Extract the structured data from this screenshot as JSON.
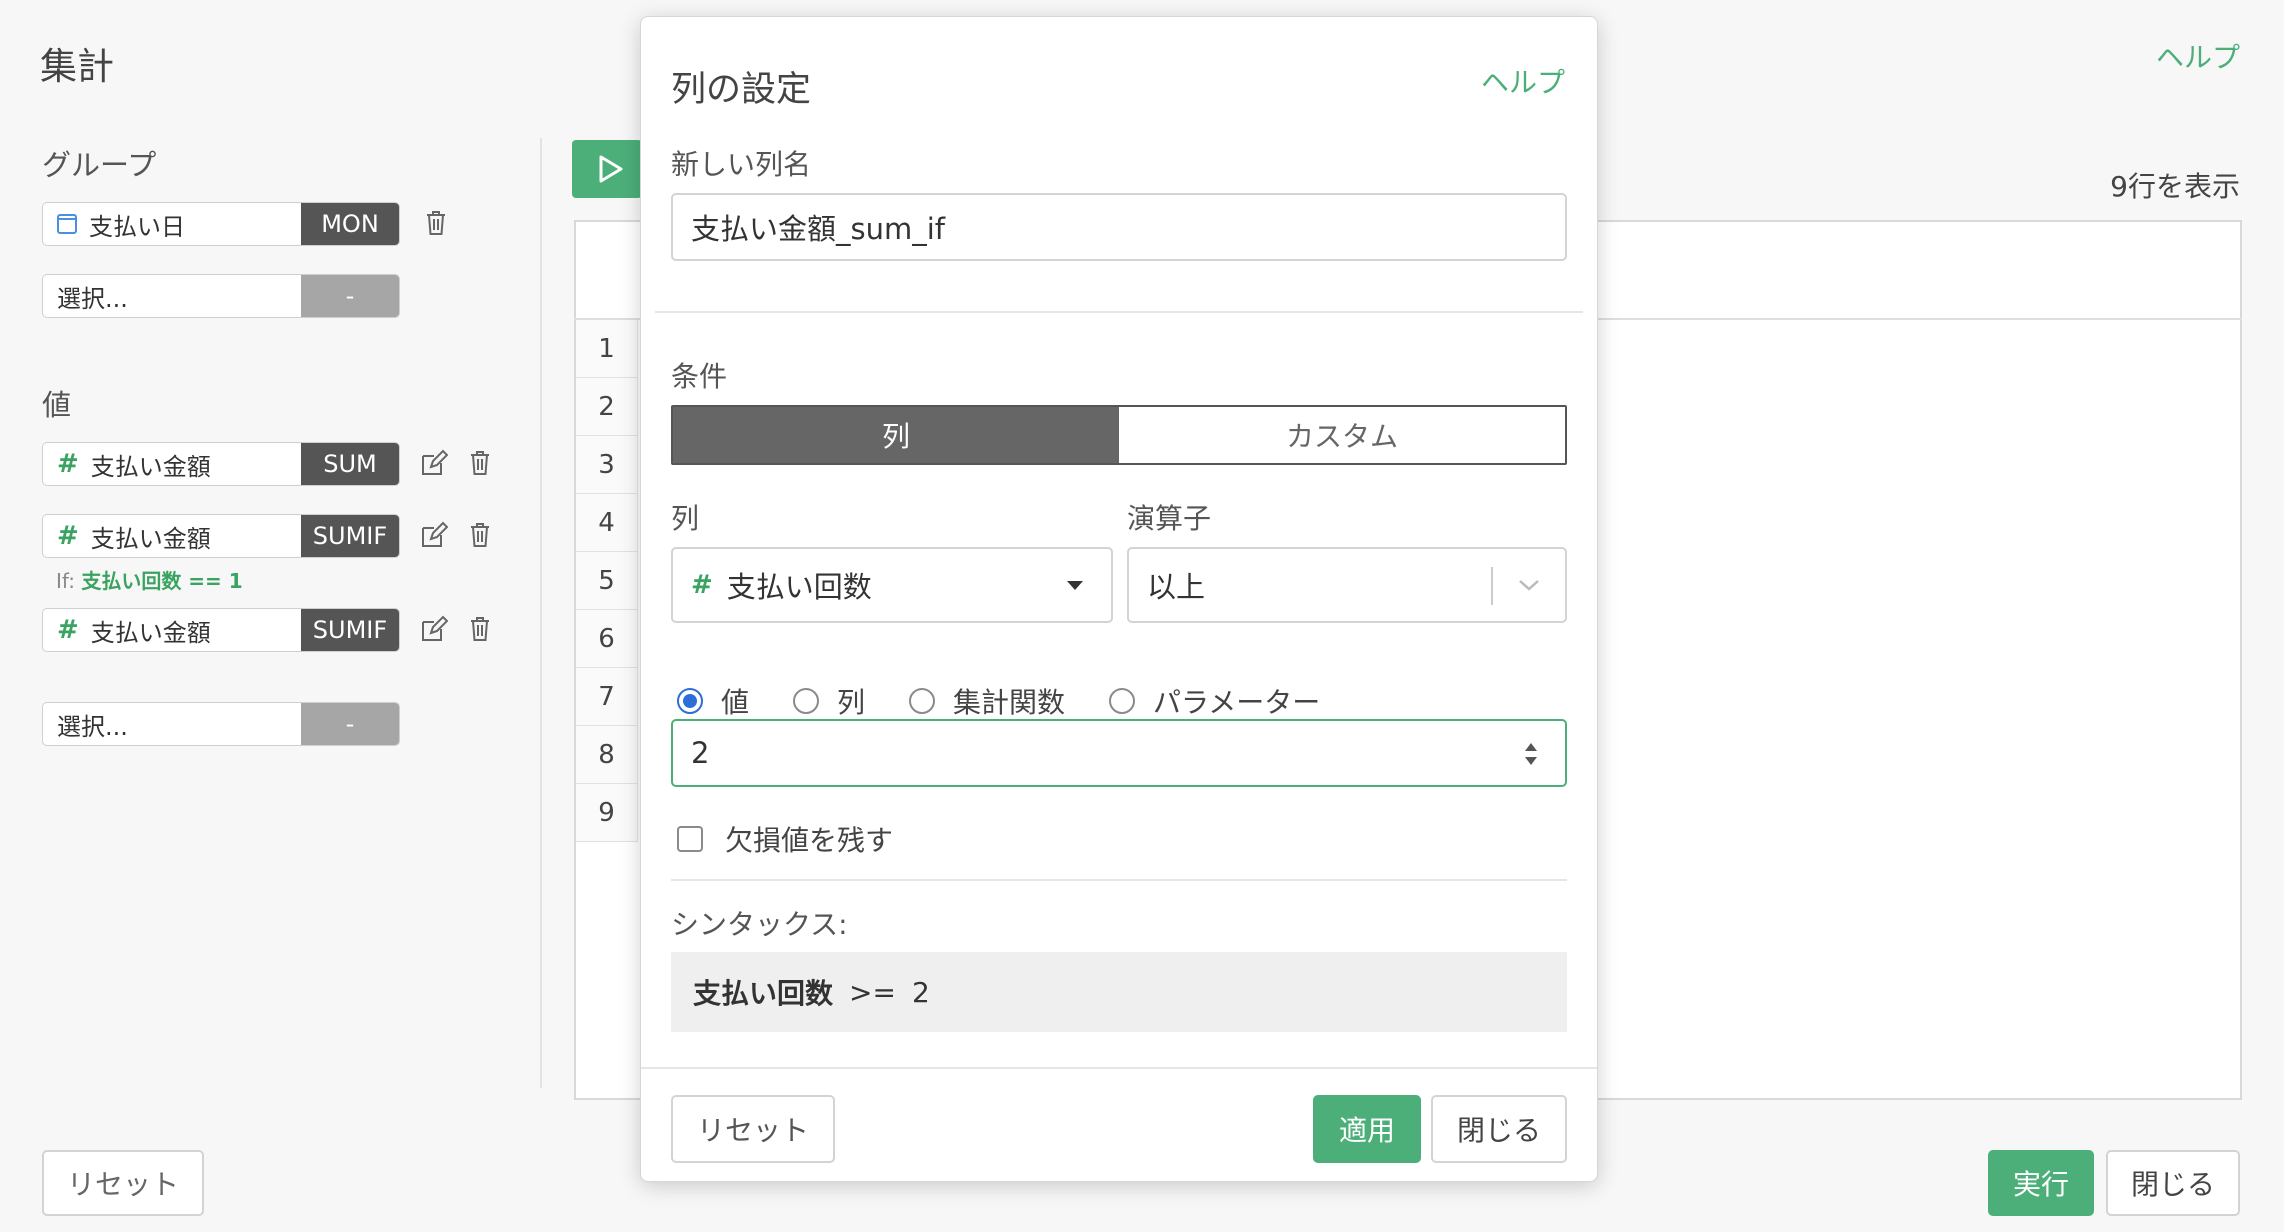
{
  "page": {
    "title": "集計",
    "help": "ヘルプ",
    "group_label": "グループ",
    "value_label": "値",
    "rows_count": "9行を表示",
    "reset": "リセット",
    "run": "実行",
    "close": "閉じる"
  },
  "groups": [
    {
      "field": "支払い日",
      "icon": "calendar-icon",
      "agg": "MON"
    },
    {
      "field": "選択...",
      "agg": "-"
    }
  ],
  "values": [
    {
      "field": "支払い金額",
      "icon": "hash-icon",
      "agg": "SUM"
    },
    {
      "field": "支払い金額",
      "icon": "hash-icon",
      "agg": "SUMIF",
      "if_prefix": "If:",
      "if_cond": "支払い回数 == 1"
    },
    {
      "field": "支払い金額",
      "icon": "hash-icon",
      "agg": "SUMIF"
    },
    {
      "field": "選択...",
      "agg": "-"
    }
  ],
  "hash_symbol": "#",
  "table": {
    "row_numbers": [
      "1",
      "2",
      "3",
      "4",
      "5",
      "6",
      "7",
      "8",
      "9"
    ]
  },
  "modal": {
    "title": "列の設定",
    "help": "ヘルプ",
    "new_col_label": "新しい列名",
    "new_col_value": "支払い金額_sum_if",
    "condition_label": "条件",
    "tabs": [
      "列",
      "カスタム"
    ],
    "active_tab": "列",
    "column_label": "列",
    "column_value": "支払い回数",
    "operator_label": "演算子",
    "operator_value": "以上",
    "radio_options": [
      "値",
      "列",
      "集計関数",
      "パラメーター"
    ],
    "radio_selected": "値",
    "value_input": "2",
    "keep_missing_label": "欠損値を残す",
    "keep_missing_checked": false,
    "syntax_label": "シンタックス:",
    "syntax_column": "支払い回数",
    "syntax_operator": ">=",
    "syntax_value": "2",
    "reset": "リセット",
    "apply": "適用",
    "close": "閉じる"
  },
  "colors": {
    "accent_green": "#4caf7a",
    "tag_dark": "#555555",
    "radio_blue": "#2d6fd6"
  }
}
